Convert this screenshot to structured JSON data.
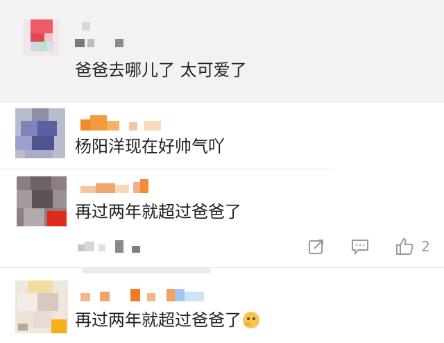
{
  "comments": [
    {
      "text": "爸爸去哪儿了 太可爱了"
    },
    {
      "text": "杨阳洋现在好帅气吖"
    },
    {
      "text": "再过两年就超过爸爸了",
      "actions": {
        "like_count": "2",
        "icons": [
          "share-icon",
          "reply-icon",
          "like-icon"
        ]
      }
    },
    {
      "text": "再过两年就超过爸爸了",
      "emoji": "thinking-face"
    }
  ],
  "colors": {
    "background_top": "#f2f2f2",
    "text": "#1f1f1f",
    "action_icon": "#9a9a9a"
  }
}
